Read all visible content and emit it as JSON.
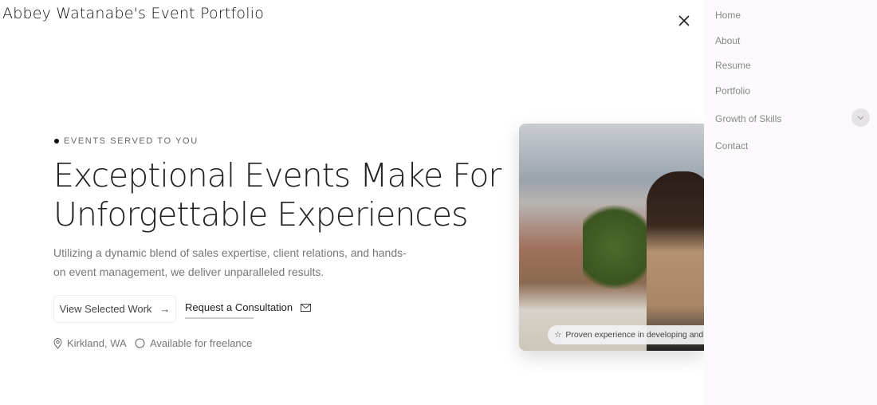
{
  "header": {
    "title": "Abbey Watanabe's Event Portfolio"
  },
  "hero": {
    "eyebrow": "EVENTS SERVED TO YOU",
    "heading_line1": "Exceptional Events Make For",
    "heading_line2": "Unforgettable Experiences",
    "lead": "Utilizing a dynamic blend of sales expertise, client relations, and hands-on event management, we deliver unparalleled results.",
    "primary_button": "View Selected Work",
    "secondary_button": "Request a Consultation",
    "location": "Kirkland, WA",
    "availability": "Available for freelance",
    "photo_badge": "Proven experience in developing and ex"
  },
  "nav": {
    "items": [
      {
        "label": "Home"
      },
      {
        "label": "About"
      },
      {
        "label": "Resume"
      },
      {
        "label": "Portfolio"
      },
      {
        "label": "Growth of Skills"
      },
      {
        "label": "Contact"
      }
    ]
  }
}
